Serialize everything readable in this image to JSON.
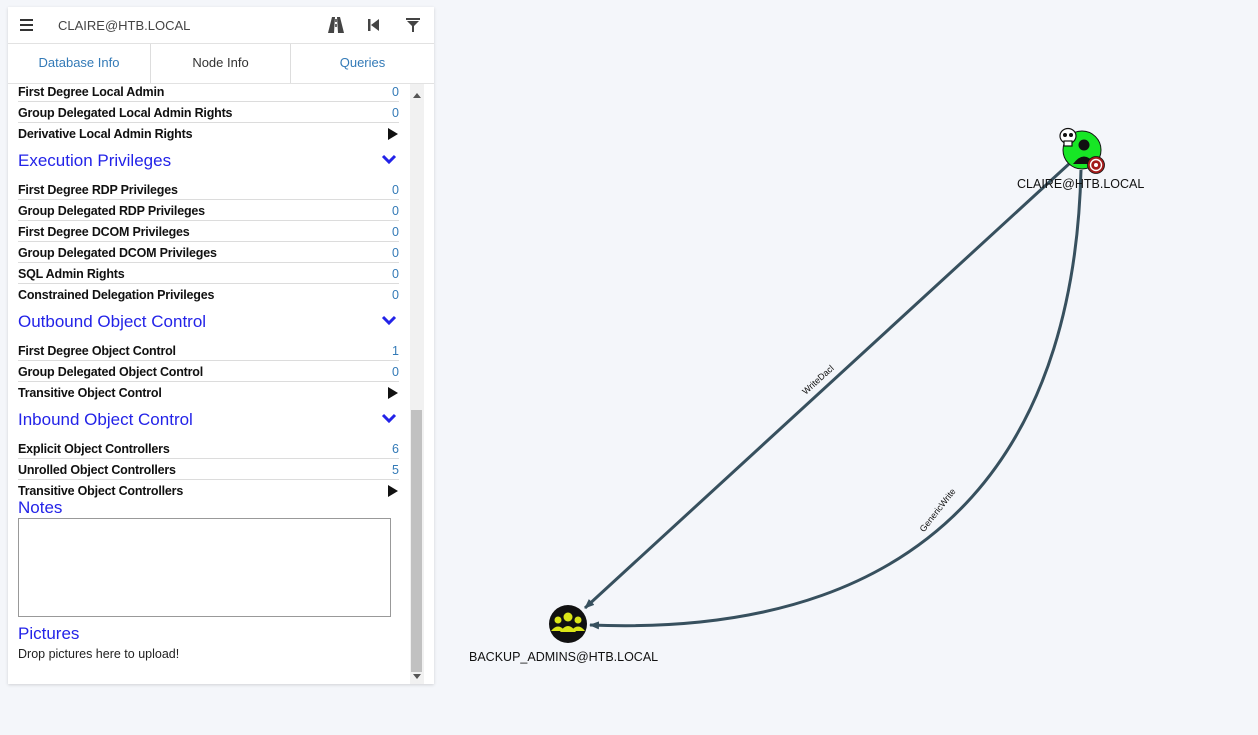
{
  "search": {
    "value": "CLAIRE@HTB.LOCAL"
  },
  "toolbar": {
    "icons": [
      "menu-icon",
      "pathfinding-road-icon",
      "back-icon",
      "filter-icon"
    ]
  },
  "tabs": [
    {
      "label": "Database Info"
    },
    {
      "label": "Node Info"
    },
    {
      "label": "Queries"
    }
  ],
  "rows": {
    "first_degree_local_admin": {
      "label": "First Degree Local Admin",
      "value": "0"
    },
    "group_delegated_local_admin": {
      "label": "Group Delegated Local Admin Rights",
      "value": "0"
    },
    "derivative_local_admin": {
      "label": "Derivative Local Admin Rights"
    },
    "first_degree_rdp": {
      "label": "First Degree RDP Privileges",
      "value": "0"
    },
    "group_delegated_rdp": {
      "label": "Group Delegated RDP Privileges",
      "value": "0"
    },
    "first_degree_dcom": {
      "label": "First Degree DCOM Privileges",
      "value": "0"
    },
    "group_delegated_dcom": {
      "label": "Group Delegated DCOM Privileges",
      "value": "0"
    },
    "sql_admin": {
      "label": "SQL Admin Rights",
      "value": "0"
    },
    "constrained_delegation": {
      "label": "Constrained Delegation Privileges",
      "value": "0"
    },
    "first_degree_object_control": {
      "label": "First Degree Object Control",
      "value": "1"
    },
    "group_delegated_object_control": {
      "label": "Group Delegated Object Control",
      "value": "0"
    },
    "transitive_object_control": {
      "label": "Transitive Object Control"
    },
    "explicit_object_controllers": {
      "label": "Explicit Object Controllers",
      "value": "6"
    },
    "unrolled_object_controllers": {
      "label": "Unrolled Object Controllers",
      "value": "5"
    },
    "transitive_object_controllers": {
      "label": "Transitive Object Controllers"
    }
  },
  "sections": {
    "execution": "Execution Privileges",
    "outbound": "Outbound Object Control",
    "inbound": "Inbound Object Control",
    "notes": "Notes",
    "pictures": "Pictures"
  },
  "pictures": {
    "drop_text": "Drop pictures here to upload!"
  },
  "graph": {
    "nodes": {
      "claire": {
        "label": "CLAIRE@HTB.LOCAL",
        "type": "user",
        "color": "#17e625",
        "owned": true,
        "target": true
      },
      "backup_admins": {
        "label": "BACKUP_ADMINS@HTB.LOCAL",
        "type": "group",
        "color": "#dbe617"
      }
    },
    "edges": [
      {
        "from": "claire",
        "to": "backup_admins",
        "label": "WriteDacl"
      },
      {
        "from": "claire",
        "to": "backup_admins",
        "label": "GenericWrite"
      }
    ],
    "edge_color": "#37505e"
  },
  "colors": {
    "link": "#337ab7",
    "section_title": "#2323e8"
  }
}
